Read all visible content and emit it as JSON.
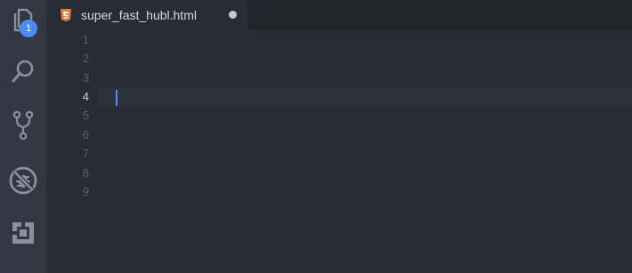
{
  "activity_bar": {
    "items": [
      {
        "name": "explorer",
        "icon": "files-icon",
        "badge": "1"
      },
      {
        "name": "search",
        "icon": "search-icon"
      },
      {
        "name": "source-control",
        "icon": "git-branch-icon"
      },
      {
        "name": "debug",
        "icon": "no-bug-icon"
      },
      {
        "name": "extensions",
        "icon": "extensions-icon"
      }
    ]
  },
  "tab": {
    "filename": "super_fast_hubl.html",
    "icon": "html5-icon",
    "dirty": true
  },
  "editor": {
    "line_numbers": [
      "1",
      "2",
      "3",
      "4",
      "5",
      "6",
      "7",
      "8",
      "9"
    ],
    "active_line": "4"
  },
  "colors": {
    "background": "#282c34",
    "activity_bar": "#333842",
    "badge": "#4a8cf2",
    "html5_icon": "#e8793d",
    "cursor": "#528bff"
  }
}
